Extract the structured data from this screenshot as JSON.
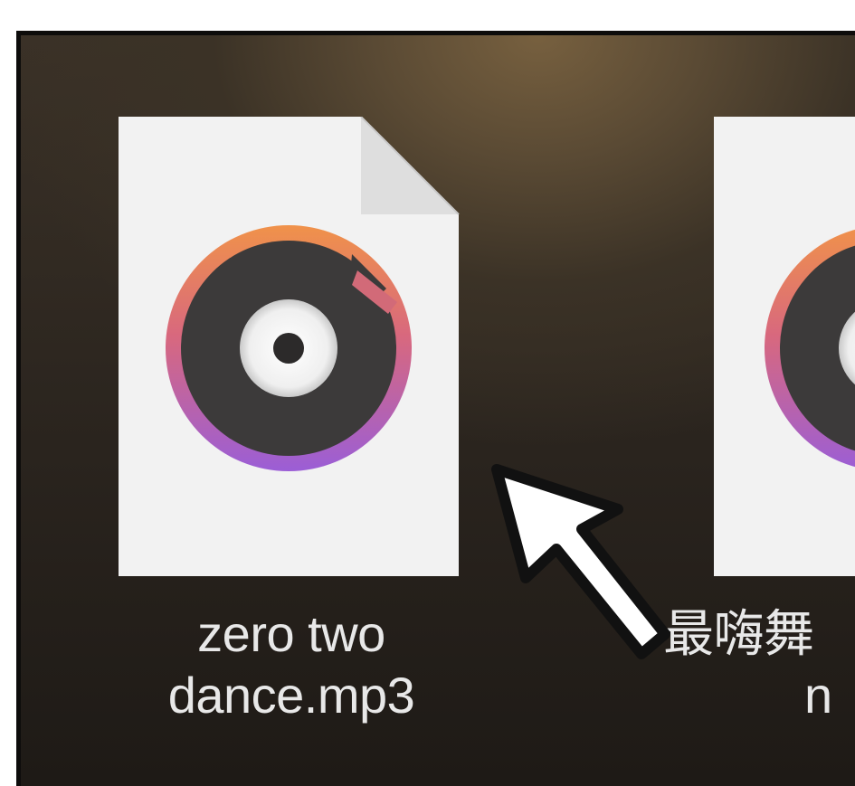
{
  "desktop": {
    "files": [
      {
        "name_line1": "zero two",
        "name_line2": "dance.mp3",
        "icon": "music-file-icon"
      },
      {
        "name_line1": "最嗨舞",
        "name_line2": "n",
        "icon": "music-file-icon"
      }
    ],
    "cursor": "arrow-cursor-icon"
  }
}
